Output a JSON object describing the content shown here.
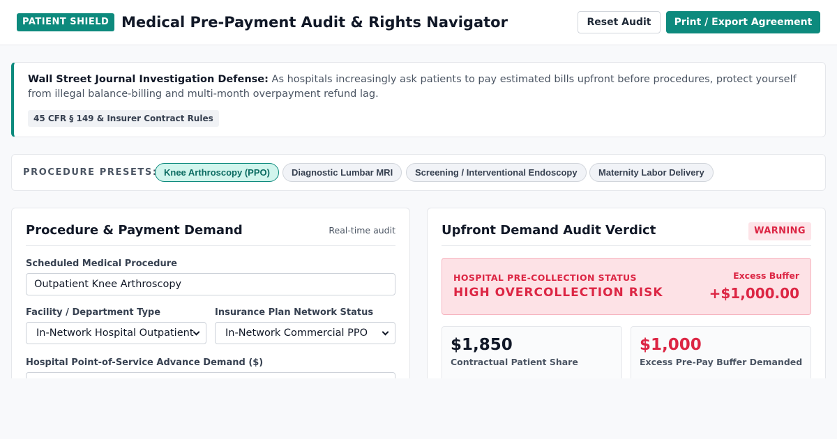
{
  "header": {
    "brand_badge": "PATIENT SHIELD",
    "title": "Medical Pre-Payment Audit & Rights Navigator",
    "reset_label": "Reset Audit",
    "print_label": "Print / Export Agreement"
  },
  "alert": {
    "heading": "Wall Street Journal Investigation Defense:",
    "body": "As hospitals increasingly ask patients to pay estimated bills upfront before procedures, protect yourself from illegal balance-billing and multi-month overpayment refund lag.",
    "chip": "45 CFR § 149 & Insurer Contract Rules"
  },
  "presets": {
    "label": "PROCEDURE PRESETS:",
    "items": [
      {
        "label": "Knee Arthroscopy (PPO)",
        "active": true
      },
      {
        "label": "Diagnostic Lumbar MRI",
        "active": false
      },
      {
        "label": "Screening / Interventional Endoscopy",
        "active": false
      },
      {
        "label": "Maternity Labor Delivery",
        "active": false
      }
    ]
  },
  "form": {
    "title": "Procedure & Payment Demand",
    "realtime_label": "Real-time audit",
    "procedure_label": "Scheduled Medical Procedure",
    "procedure_value": "Outpatient Knee Arthroscopy",
    "facility_label": "Facility / Department Type",
    "facility_value": "In-Network Hospital Outpatient",
    "network_label": "Insurance Plan Network Status",
    "network_value": "In-Network Commercial PPO",
    "demand_label": "Hospital Point-of-Service Advance Demand ($)"
  },
  "verdict": {
    "title": "Upfront Demand Audit Verdict",
    "badge": "WARNING",
    "status_kicker": "HOSPITAL PRE-COLLECTION STATUS",
    "status_main": "HIGH OVERCOLLECTION RISK",
    "buffer_label": "Excess Buffer",
    "buffer_value": "+$1,000.00",
    "metrics": [
      {
        "value": "$1,850",
        "label": "Contractual Patient Share"
      },
      {
        "value": "$1,000",
        "label": "Excess Pre-Pay Buffer Demanded"
      }
    ]
  },
  "colors": {
    "brand": "#0d8a7d",
    "warning": "#dc2644",
    "warning_bg": "#fde2e6"
  }
}
